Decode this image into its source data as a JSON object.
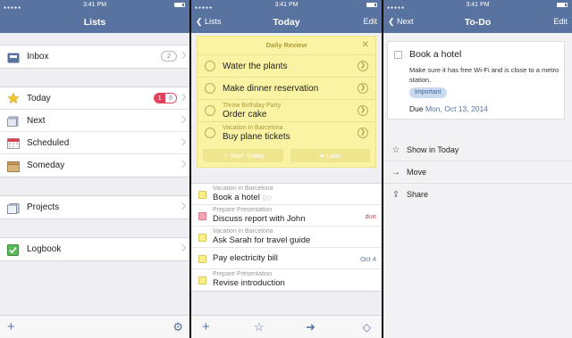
{
  "status": {
    "time": "3:41 PM"
  },
  "lists": {
    "title": "Lists",
    "inbox": {
      "label": "Inbox",
      "count": "2"
    },
    "items": [
      {
        "label": "Today",
        "badge_due": "1",
        "badge_count": "8",
        "icon": "star-icon"
      },
      {
        "label": "Next",
        "icon": "layers-icon"
      },
      {
        "label": "Scheduled",
        "icon": "calendar-icon"
      },
      {
        "label": "Someday",
        "icon": "box-icon"
      }
    ],
    "projects": {
      "label": "Projects"
    },
    "logbook": {
      "label": "Logbook"
    }
  },
  "today": {
    "back": "Lists",
    "title": "Today",
    "edit": "Edit",
    "review": {
      "title": "Daily Review",
      "items": [
        {
          "project": "",
          "title": "Water the plants"
        },
        {
          "project": "",
          "title": "Make dinner reservation"
        },
        {
          "project": "Throw Birthday Party",
          "title": "Order cake"
        },
        {
          "project": "Vacation in Barcelona",
          "title": "Buy plane tickets"
        }
      ],
      "start_label": "Start Today",
      "later_label": "Later"
    },
    "tasks": [
      {
        "project": "Vacation in Barcelona",
        "title": "Book a hotel",
        "due": "",
        "color": "yellow"
      },
      {
        "project": "Prepare Presentation",
        "title": "Discuss report with John",
        "due": "due",
        "color": "red"
      },
      {
        "project": "Vacation in Barcelona",
        "title": "Ask Sarah for travel guide",
        "due": "",
        "color": "yellow"
      },
      {
        "project": "",
        "title": "Pay electricity bill",
        "due": "Oct 4",
        "color": "yellow"
      },
      {
        "project": "Prepare Presentation",
        "title": "Revise introduction",
        "due": "",
        "color": "yellow"
      }
    ]
  },
  "todo": {
    "back": "Next",
    "title": "To-Do",
    "edit": "Edit",
    "task_title": "Book a hotel",
    "note": "Make sure it has free Wi-Fi and is close to a metro station.",
    "tag": "Important",
    "due_label": "Due",
    "due_date": "Mon, Oct 13, 2014",
    "actions": [
      {
        "label": "Show in Today",
        "icon": "star-icon"
      },
      {
        "label": "Move",
        "icon": "arrow-right-icon"
      },
      {
        "label": "Share",
        "icon": "share-icon"
      }
    ]
  },
  "colors": {
    "navbar": "#5873a0",
    "due_red": "#e0405b",
    "date_blue": "#5873a0",
    "review_yellow": "#fbf3a4"
  }
}
